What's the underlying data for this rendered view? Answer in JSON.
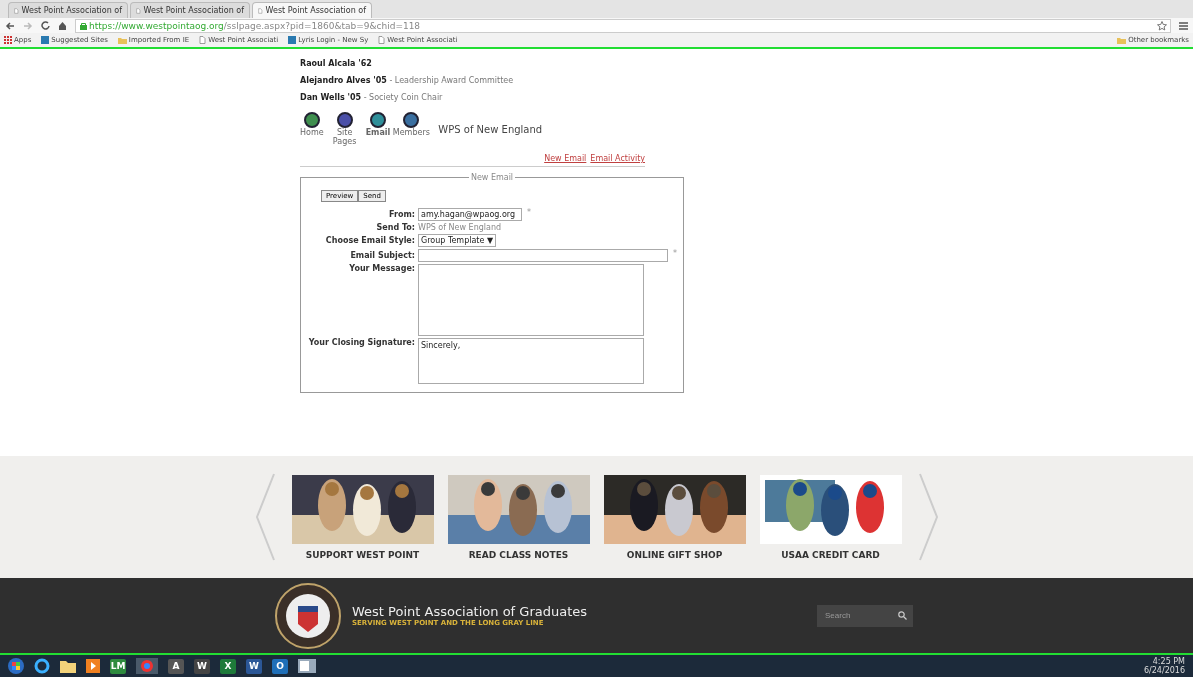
{
  "browser": {
    "tabs": [
      {
        "title": "West Point Association of",
        "selected": false
      },
      {
        "title": "West Point Association of",
        "selected": false
      },
      {
        "title": "West Point Association of",
        "selected": true
      }
    ],
    "url": {
      "host": "https://www.westpointaog.org",
      "path": "/sslpage.aspx?pid=1860&tab=9&chid=118"
    },
    "bookmarks": [
      {
        "label": "Apps",
        "kind": "apps"
      },
      {
        "label": "Suggested Sites",
        "kind": "site"
      },
      {
        "label": "Imported From IE",
        "kind": "folder"
      },
      {
        "label": "West Point Associati",
        "kind": "page"
      },
      {
        "label": "Lyris Login - New Sy",
        "kind": "site"
      },
      {
        "label": "West Point Associati",
        "kind": "page"
      }
    ],
    "other_bookmarks": "Other bookmarks"
  },
  "people": [
    {
      "name": "Raoul Alcala '62"
    },
    {
      "name": "Alejandro Alves '05",
      "role": " - Leadership Award Committee"
    },
    {
      "name": "Dan Wells '05",
      "role": " - Society Coin Chair"
    }
  ],
  "group_nav": {
    "items": [
      {
        "label": "Home",
        "color": "#3f8f4f",
        "selected": false
      },
      {
        "label": "Site Pages",
        "color": "#4a4fa8",
        "selected": false
      },
      {
        "label": "Email",
        "color": "#2f8f9a",
        "selected": true
      },
      {
        "label": "Members",
        "color": "#3a6fa0",
        "selected": false
      }
    ],
    "group_name": "WPS of New England"
  },
  "email_links": [
    "New Email",
    "Email Activity"
  ],
  "new_email": {
    "legend": "New Email",
    "buttons": [
      "Preview",
      "Send"
    ],
    "from": {
      "label": "From:",
      "value": "amy.hagan@wpaog.org",
      "required_mark": "*"
    },
    "send_to": {
      "label": "Send To:",
      "value": "WPS of New England"
    },
    "style": {
      "label": "Choose Email Style:",
      "value": "Group Template",
      "caret": "▼"
    },
    "subject": {
      "label": "Email Subject:",
      "required_mark": "*"
    },
    "message": {
      "label": "Your Message:"
    },
    "signature": {
      "label": "Your Closing Signature:",
      "value": "Sincerely,"
    }
  },
  "promos": [
    {
      "caption": "SUPPORT WEST POINT",
      "kind": "picture"
    },
    {
      "caption": "READ CLASS NOTES",
      "kind": "picture"
    },
    {
      "caption": "ONLINE GIFT SHOP",
      "kind": "picture"
    },
    {
      "caption": "USAA CREDIT CARD",
      "kind": "picture"
    }
  ],
  "footer": {
    "title": "West Point Association of Graduates",
    "tagline": "SERVING WEST POINT AND THE LONG GRAY LINE",
    "search": {
      "placeholder": "Search"
    }
  },
  "taskbar": {
    "apps": [
      {
        "kind": "start"
      },
      {
        "kind": "ie"
      },
      {
        "kind": "folder"
      },
      {
        "kind": "media"
      },
      {
        "kind": "letter",
        "label": "LM",
        "color": "#2e8b3e"
      },
      {
        "kind": "chrome"
      },
      {
        "kind": "letter",
        "label": "A",
        "color": "#555555"
      },
      {
        "kind": "letter",
        "label": "W",
        "color": "#444444"
      },
      {
        "kind": "letter",
        "label": "X",
        "color": "#1e7a3a"
      },
      {
        "kind": "letter",
        "label": "W",
        "color": "#2b5797"
      },
      {
        "kind": "letter",
        "label": "O",
        "color": "#1f6fb8"
      },
      {
        "kind": "window"
      }
    ],
    "time": "4:25 PM",
    "date": "6/24/2016"
  }
}
